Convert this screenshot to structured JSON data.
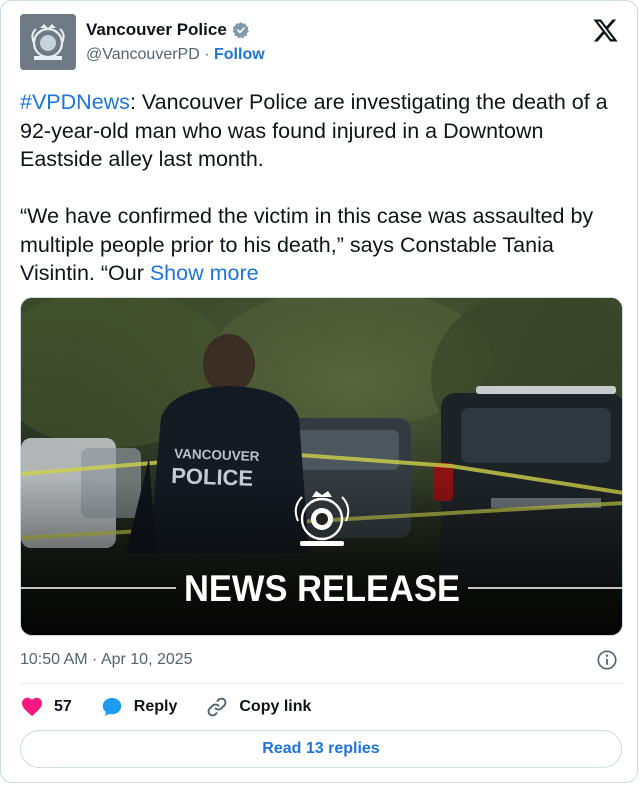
{
  "author": {
    "name": "Vancouver Police",
    "handle": "@VancouverPD",
    "separator": " · ",
    "follow_label": "Follow"
  },
  "tweet": {
    "hashtag": "#VPDNews",
    "body": ": Vancouver Police are investigating the death of a 92-year-old man who was found injured in a Downtown Eastside alley last month.\n\n“We have confirmed the victim in this case was assaulted by multiple people prior to his death,” says Constable Tania Visintin. “Our ",
    "show_more": "Show more"
  },
  "media": {
    "jacket_line1": "VANCOUVER",
    "jacket_line2": "POLICE",
    "banner": "NEWS RELEASE"
  },
  "timestamp": "10:50 AM · Apr 10, 2025",
  "actions": {
    "likes": "57",
    "reply_label": "Reply",
    "copy_link_label": "Copy link"
  },
  "read_replies_label": "Read 13 replies",
  "colors": {
    "link": "#1d74d9",
    "heart": "#f91880",
    "verified": "#829aab"
  }
}
